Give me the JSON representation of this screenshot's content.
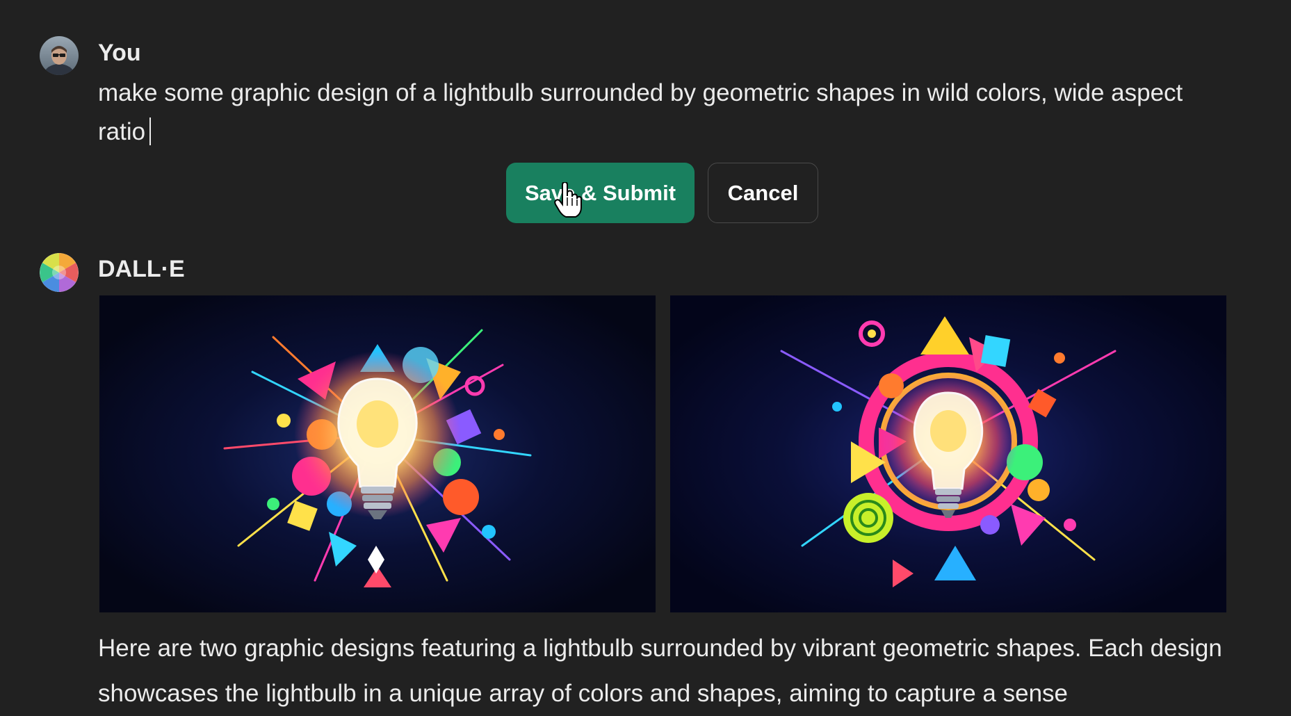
{
  "conversation": {
    "user": {
      "author": "You",
      "avatar_icon": "user-avatar-icon",
      "message": "make some graphic design of a lightbulb surrounded by geometric shapes in wild colors, wide aspect ratio"
    },
    "edit_actions": {
      "save_label": "Save & Submit",
      "cancel_label": "Cancel",
      "save_color": "#19805f"
    },
    "assistant": {
      "author": "DALL·E",
      "avatar_icon": "dalle-logo-icon",
      "images": [
        "lightbulb-design-1",
        "lightbulb-design-2"
      ],
      "response": "Here are two graphic designs featuring a lightbulb surrounded by vibrant geometric shapes. Each design showcases the lightbulb in a unique array of colors and shapes, aiming to capture a sense"
    }
  }
}
